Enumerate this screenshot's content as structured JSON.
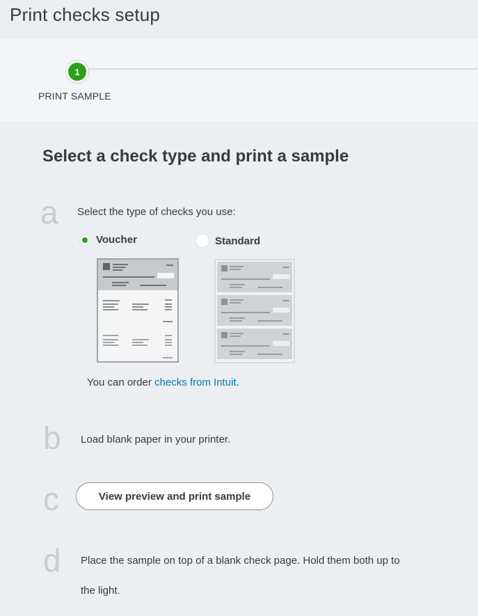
{
  "page": {
    "title": "Print checks setup"
  },
  "stepper": {
    "step_number": "1",
    "step_label": "PRINT SAMPLE"
  },
  "main": {
    "heading": "Select a check type and print a sample",
    "steps": {
      "a": {
        "letter": "a",
        "text": "Select the type of checks you use:",
        "options": [
          {
            "label": "Voucher",
            "selected": true
          },
          {
            "label": "Standard",
            "selected": false
          }
        ],
        "order_text_prefix": "You can order ",
        "order_link": "checks from Intuit",
        "order_text_suffix": "."
      },
      "b": {
        "letter": "b",
        "text": "Load blank paper in your printer."
      },
      "c": {
        "letter": "c",
        "button_label": "View preview and print sample"
      },
      "d": {
        "letter": "d",
        "text_line1": "Place the sample on top of a blank check page. Hold them both up to",
        "text_line2": "the light."
      }
    }
  },
  "colors": {
    "accent_green": "#2ca01c",
    "link_blue": "#0077c5",
    "text": "#393a3d"
  },
  "icons": {
    "selected_radio": "radio-selected-icon",
    "unselected_radio": "radio-unselected-icon"
  }
}
